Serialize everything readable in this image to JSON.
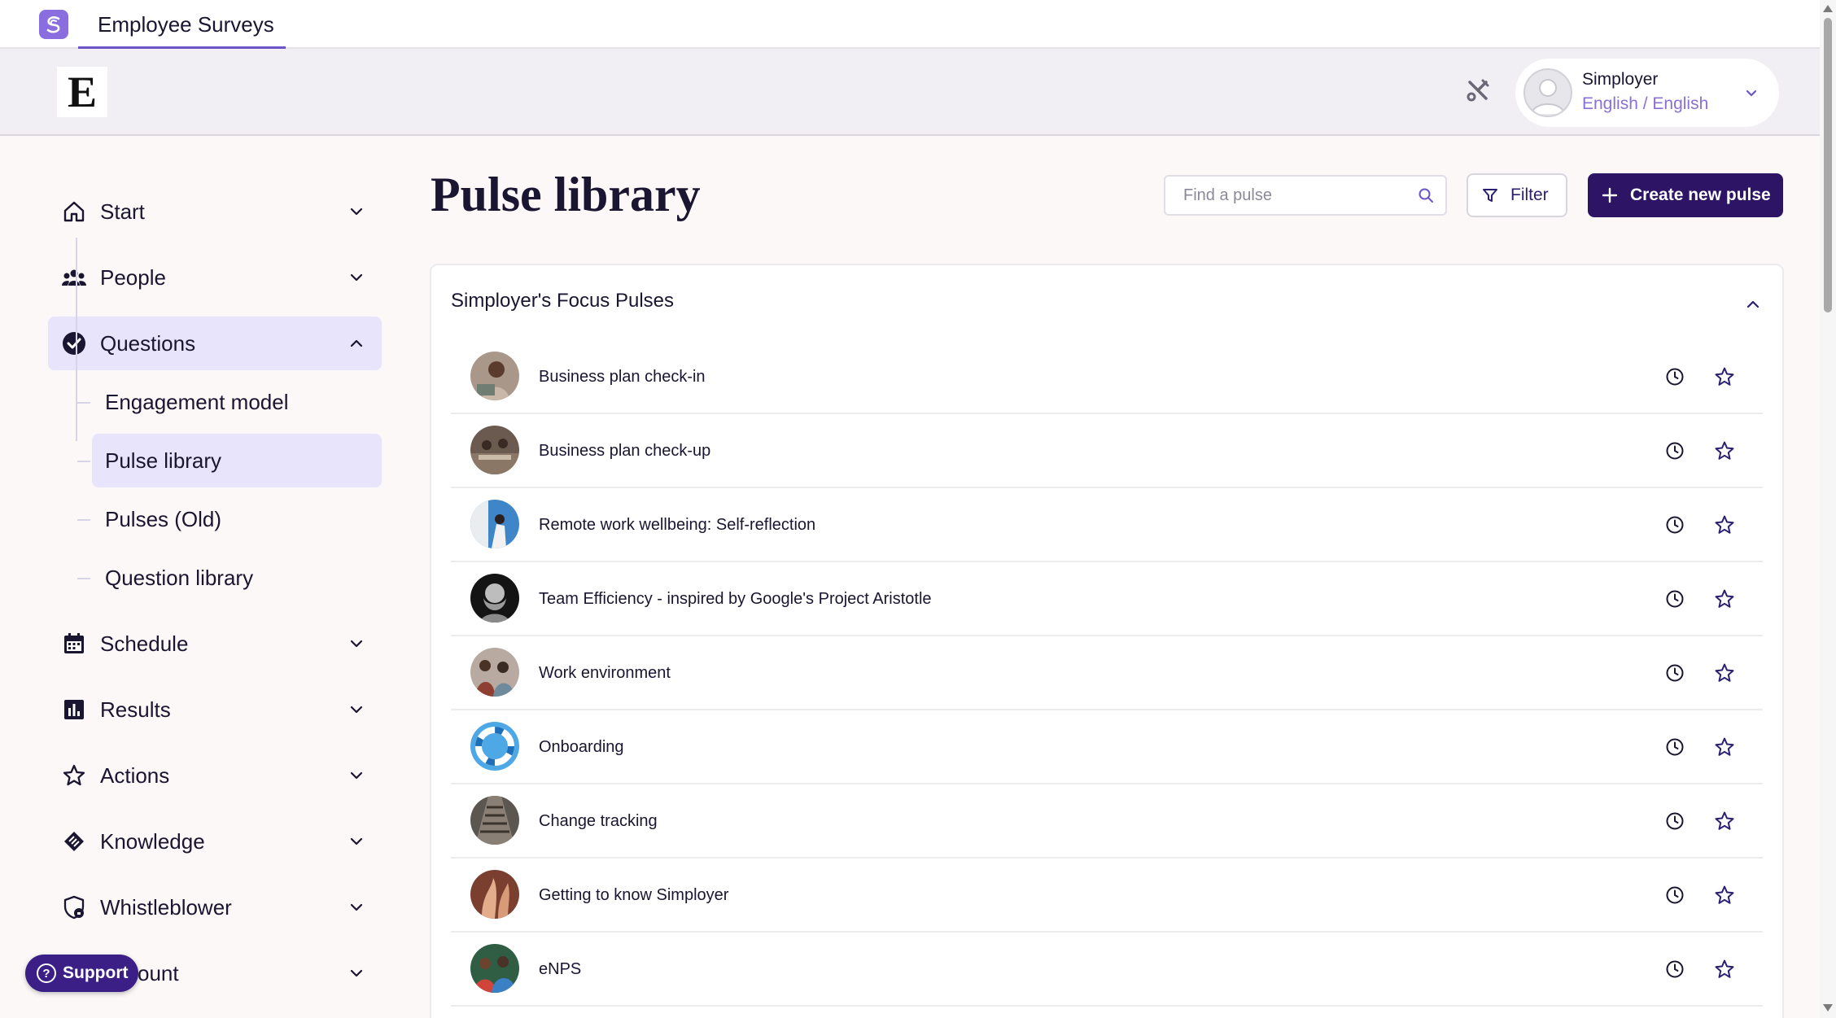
{
  "app": {
    "tab_title": "Employee Surveys",
    "company_logo_letter": "E"
  },
  "user": {
    "name": "Simployer",
    "language": "English / English"
  },
  "sidebar": {
    "items": [
      {
        "label": "Start",
        "icon": "home-icon"
      },
      {
        "label": "People",
        "icon": "people-icon"
      },
      {
        "label": "Questions",
        "icon": "check-circle-icon"
      },
      {
        "label": "Schedule",
        "icon": "calendar-icon"
      },
      {
        "label": "Results",
        "icon": "bar-chart-icon"
      },
      {
        "label": "Actions",
        "icon": "star-icon"
      },
      {
        "label": "Knowledge",
        "icon": "knowledge-icon"
      },
      {
        "label": "Whistleblower",
        "icon": "shield-lock-icon"
      },
      {
        "label": "ount",
        "icon": "account-icon"
      }
    ],
    "sub_items": [
      {
        "label": "Engagement model"
      },
      {
        "label": "Pulse library"
      },
      {
        "label": "Pulses (Old)"
      },
      {
        "label": "Question library"
      }
    ],
    "support_label": "Support"
  },
  "main": {
    "title": "Pulse library",
    "search_placeholder": "Find a pulse",
    "filter_label": "Filter",
    "create_label": "Create new pulse",
    "section_title": "Simployer's Focus Pulses",
    "pulses": [
      {
        "label": "Business plan check-in"
      },
      {
        "label": "Business plan check-up"
      },
      {
        "label": "Remote work wellbeing: Self-reflection"
      },
      {
        "label": "Team Efficiency - inspired by Google's Project Aristotle"
      },
      {
        "label": "Work environment"
      },
      {
        "label": "Onboarding"
      },
      {
        "label": "Change tracking"
      },
      {
        "label": "Getting to know Simployer"
      },
      {
        "label": "eNPS"
      }
    ]
  },
  "colors": {
    "brand_dark": "#2d1465",
    "brand_light": "#e8e4fb",
    "accent_text": "#8a70d6"
  }
}
